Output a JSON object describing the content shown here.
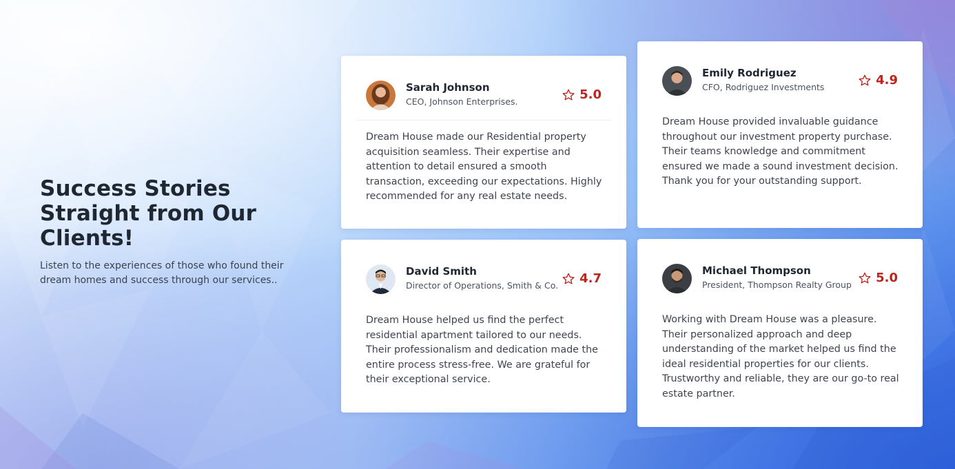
{
  "section": {
    "title": "Success Stories Straight from Our Clients!",
    "subtitle": "Listen to the experiences of those who found their dream homes and success through our services.."
  },
  "colors": {
    "accent": "#b8261d",
    "heading": "#1f2733",
    "text": "#3e4450",
    "card": "#ffffff"
  },
  "testimonials": [
    {
      "name": "Sarah Johnson",
      "role": "CEO, Johnson Enterprises.",
      "rating": "5.0",
      "icon": "star-outline-icon",
      "quote": "Dream House made our Residential property acquisition seamless. Their expertise and attention to detail ensured a smooth transaction, exceeding our expectations. Highly recommended for any real estate needs."
    },
    {
      "name": "Emily Rodriguez",
      "role": "CFO, Rodriguez Investments",
      "rating": "4.9",
      "icon": "star-outline-icon",
      "quote": "Dream House provided invaluable guidance throughout our investment property purchase. Their teams knowledge and commitment ensured we made a sound investment decision. Thank you for your outstanding support."
    },
    {
      "name": "David Smith",
      "role": "Director of Operations, Smith & Co.",
      "rating": "4.7",
      "icon": "star-outline-icon",
      "quote": "Dream House helped us find the perfect residential apartment tailored to our needs. Their professionalism and dedication made the entire process stress-free. We are grateful for their exceptional service."
    },
    {
      "name": "Michael Thompson",
      "role": "President, Thompson Realty Group",
      "rating": "5.0",
      "icon": "star-outline-icon",
      "quote": "Working with Dream House was a pleasure. Their personalized approach and deep understanding of the market helped us find the ideal residential properties for our clients. Trustworthy and reliable, they are our go-to real estate partner."
    }
  ]
}
